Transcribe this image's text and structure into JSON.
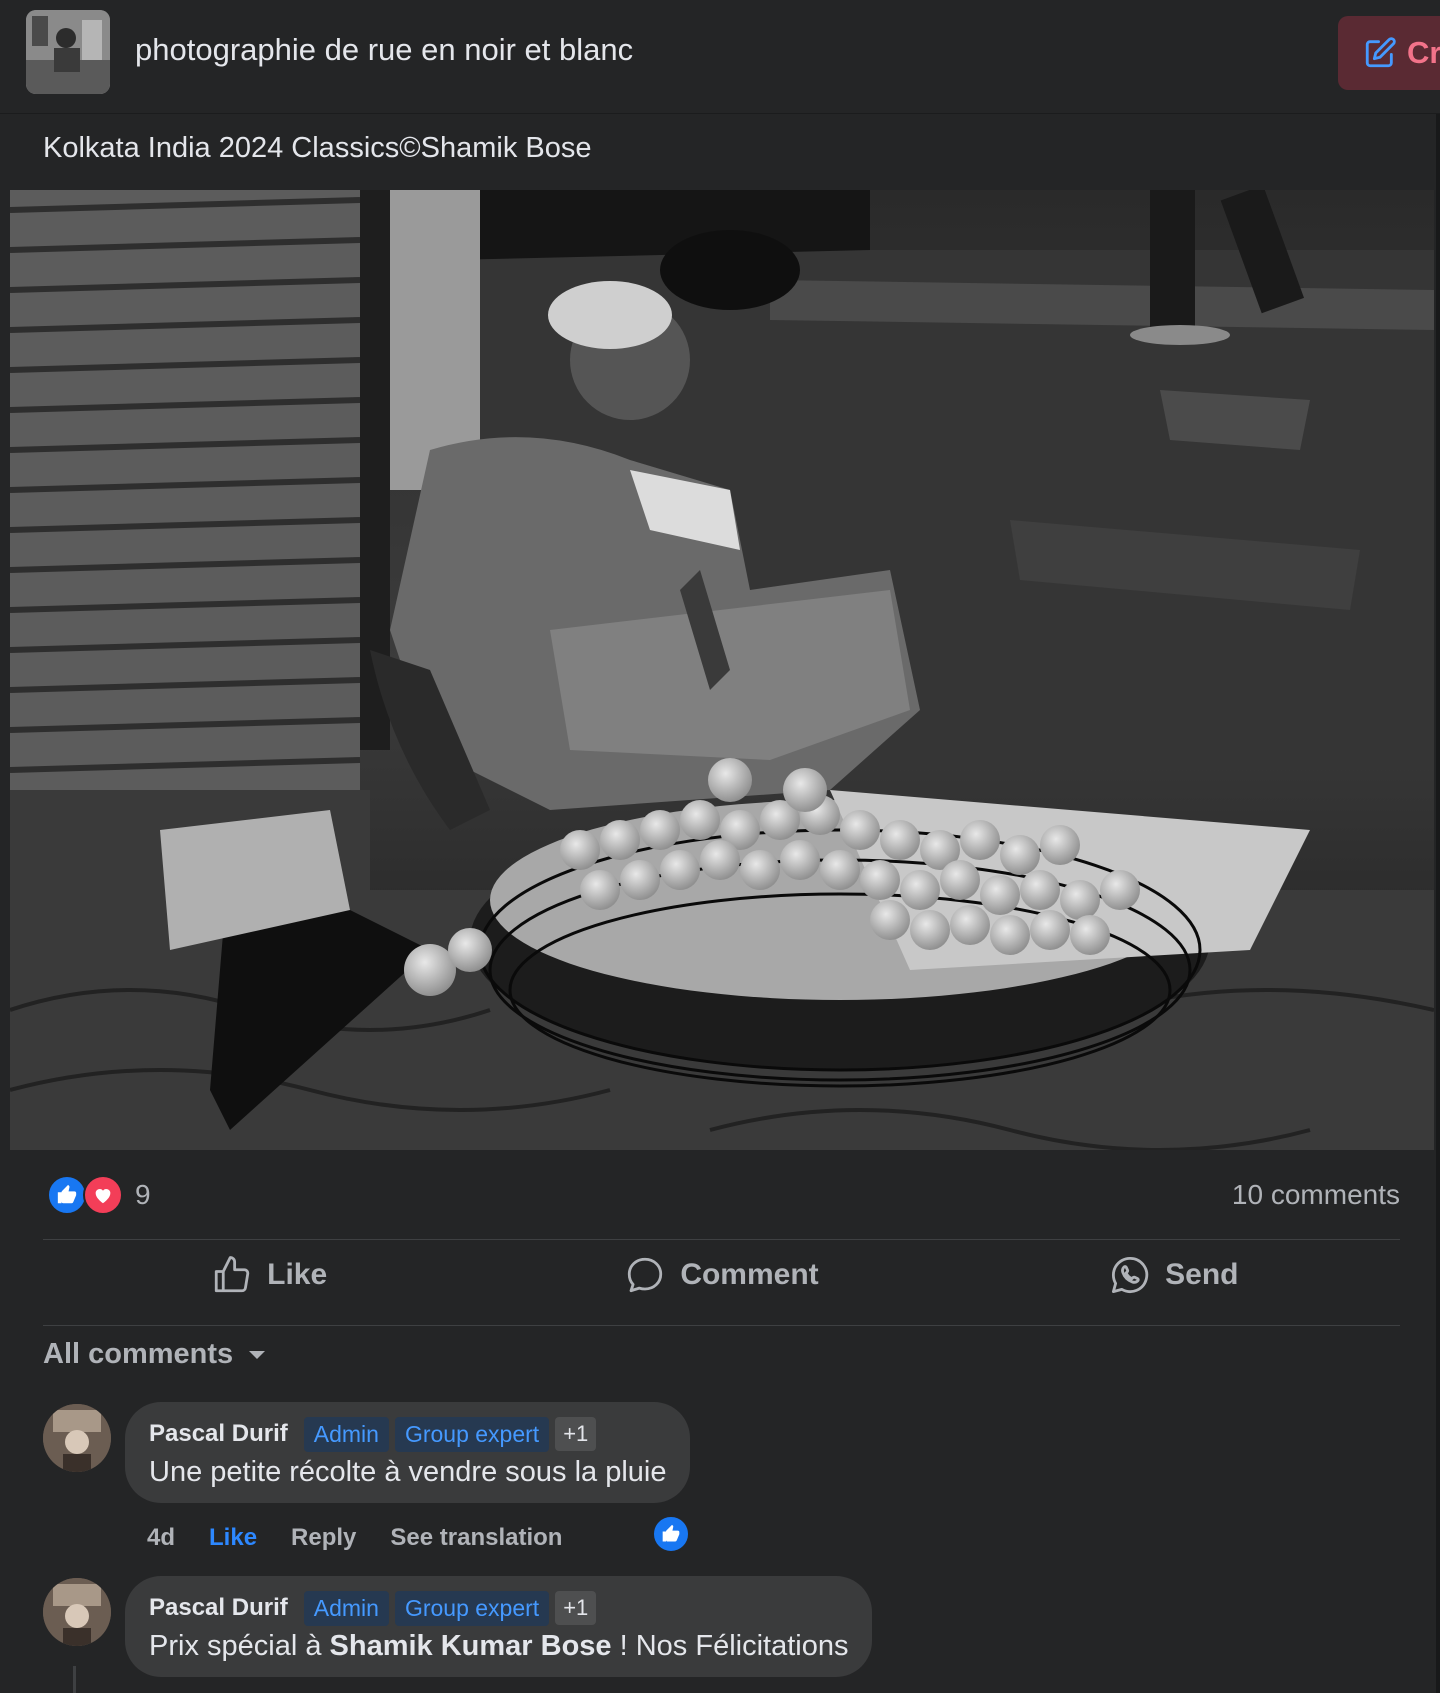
{
  "group": {
    "name": "photographie de rue en noir et blanc",
    "create_label": "Cr"
  },
  "post": {
    "caption": "Kolkata India 2024 Classics©Shamik Bose",
    "reaction_count": "9",
    "reactions": [
      "like",
      "love"
    ],
    "comments_count": "10 comments",
    "actions": {
      "like": "Like",
      "comment": "Comment",
      "send": "Send"
    },
    "comments_filter": "All comments"
  },
  "comments": [
    {
      "author": "Pascal Durif",
      "badges": [
        "Admin",
        "Group expert"
      ],
      "badge_more": "+1",
      "text": "Une petite récolte à vendre sous la pluie",
      "time": "4d",
      "like_label": "Like",
      "reply_label": "Reply",
      "translate_label": "See translation",
      "liked": true
    },
    {
      "author": "Pascal Durif",
      "badges": [
        "Admin",
        "Group expert"
      ],
      "badge_more": "+1",
      "text_prefix": "Prix spécial à ",
      "text_mention": "Shamik Kumar Bose",
      "text_suffix": " ! Nos Félicitations"
    }
  ],
  "colors": {
    "background": "#242526",
    "accent_blue": "#1877f2",
    "badge_blue": "#4599ff",
    "love_red": "#f33e58",
    "create_button": "#5a2a33"
  }
}
